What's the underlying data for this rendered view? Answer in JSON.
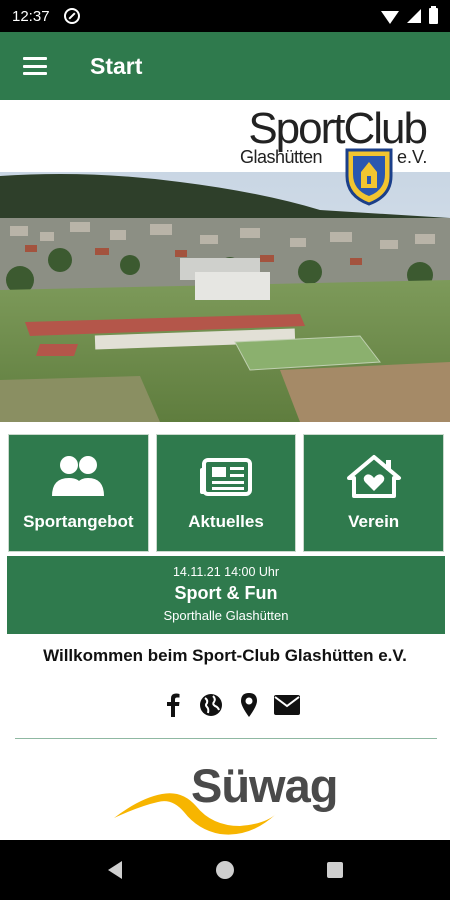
{
  "status_bar": {
    "time": "12:37"
  },
  "app_bar": {
    "title": "Start"
  },
  "hero": {
    "logo_main": "SportClub",
    "logo_sub_left": "Glashütten",
    "logo_sub_right": "e.V."
  },
  "tiles": [
    {
      "label": "Sportangebot",
      "icon": "group-icon"
    },
    {
      "label": "Aktuelles",
      "icon": "newspaper-icon"
    },
    {
      "label": "Verein",
      "icon": "house-heart-icon"
    }
  ],
  "event": {
    "date": "14.11.21 14:00 Uhr",
    "title": "Sport & Fun",
    "location": "Sporthalle Glashütten"
  },
  "welcome": "Willkommen beim Sport-Club Glashütten e.V.",
  "social": [
    "facebook-icon",
    "globe-icon",
    "location-pin-icon",
    "mail-icon"
  ],
  "sponsor": {
    "name": "Süwag",
    "accent": "#f7b500"
  },
  "colors": {
    "primary": "#2f7a4d"
  }
}
